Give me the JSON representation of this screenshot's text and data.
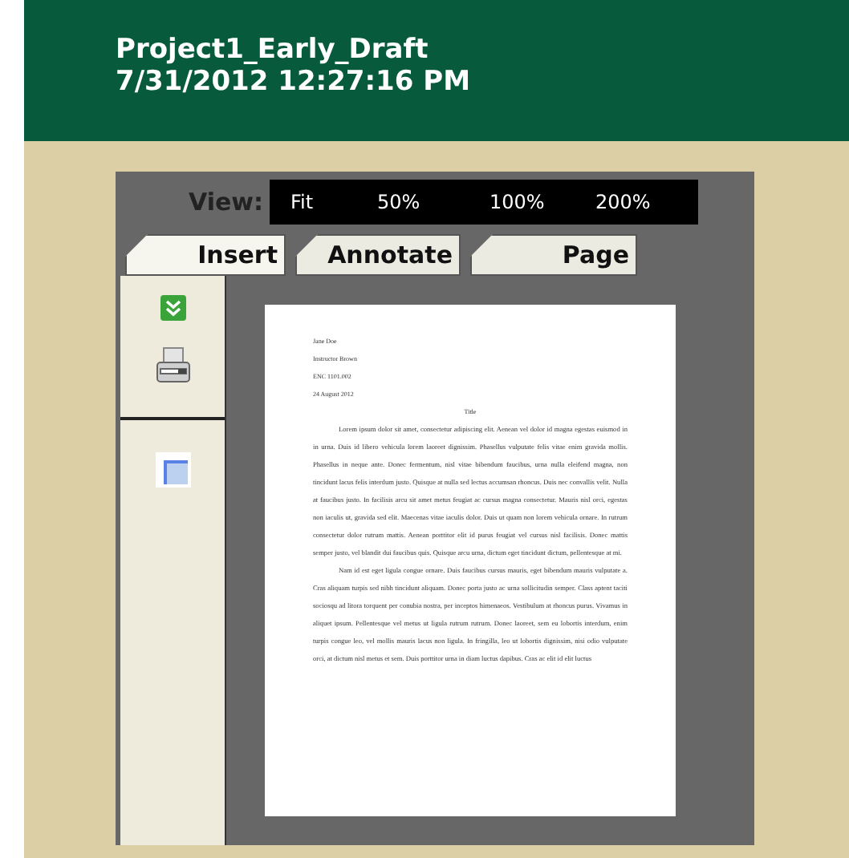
{
  "header": {
    "title": "Project1_Early_Draft",
    "timestamp": "7/31/2012 12:27:16 PM"
  },
  "view": {
    "label": "View:",
    "options": [
      {
        "label": "Fit",
        "selected": false
      },
      {
        "label": "50%",
        "selected": false
      },
      {
        "label": "100%",
        "selected": false
      },
      {
        "label": "200%",
        "selected": false
      }
    ]
  },
  "tabs": [
    {
      "label": "Insert",
      "selected": true
    },
    {
      "label": "Annotate",
      "selected": false
    },
    {
      "label": "Page",
      "selected": false
    }
  ],
  "sidebar": {
    "tools": [
      {
        "kind": "expand"
      },
      {
        "kind": "print"
      },
      {
        "kind": "divider"
      },
      {
        "kind": "thumbnail"
      }
    ]
  },
  "document": {
    "heading_lines": [
      "Jane Doe",
      "Instructor Brown",
      "ENC 1101.002",
      "24 August 2012"
    ],
    "title": "Title",
    "paragraphs": [
      "Lorem ipsum dolor sit amet, consectetur adipiscing elit. Aenean vel dolor id magna egestas euismod in in urna. Duis id libero vehicula lorem laoreet dignissim. Phasellus vulputate felis vitae enim gravida mollis. Phasellus in neque ante. Donec fermentum, nisl vitae bibendum faucibus, urna nulla eleifend magna, non tincidunt lacus felis interdum justo. Quisque at nulla sed lectus accumsan rhoncus. Duis nec convallis velit. Nulla at faucibus justo. In facilisis arcu sit amet metus feugiat ac cursus magna consectetur. Mauris nisl orci, egestas non iaculis ut, gravida sed elit. Maecenas vitae iaculis dolor. Duis ut quam non lorem vehicula ornare. In rutrum consectetur dolor rutrum mattis. Aenean porttitor elit id purus feugiat vel cursus nisl facilisis. Donec mattis semper justo, vel blandit dui faucibus quis. Quisque arcu urna, dictum eget tincidunt dictum, pellentesque at mi.",
      "Nam id est eget ligula congue ornare. Duis faucibus cursus mauris, eget bibendum mauris vulputate a. Cras aliquam turpis sed nibh tincidunt aliquam. Donec porta justo ac urna sollicitudin semper. Class aptent taciti sociosqu ad litora torquent per conubia nostra, per inceptos himenaeos. Vestibulum at rhoncus purus. Vivamus in aliquet ipsum. Pellentesque vel metus ut ligula rutrum rutrum. Donec laoreet, sem eu lobortis interdum, enim turpis congue leo, vel mollis mauris lacus non ligula. In fringilla, leo ut lobortis dignissim, nisi odio vulputate orci, at dictum nisl metus et sem. Duis porttitor urna in diam luctus dapibus. Cras ac elit id elit luctus"
    ]
  }
}
